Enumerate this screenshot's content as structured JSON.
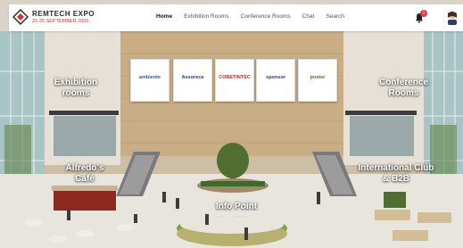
{
  "header": {
    "logo_title": "REMTECH EXPO",
    "logo_subtitle": "21-25 SEPTEMBER 2020",
    "nav": [
      "Home",
      "Exhibition Rooms",
      "Conference Rooms",
      "Chat",
      "Search"
    ],
    "notification_count": "1"
  },
  "scene": {
    "hotspots": {
      "exhibition": "Exhibition rooms",
      "conference": "Conference Rooms",
      "cafe": "Alfredo's Café",
      "club": "International Club & B2B",
      "info": "Info Point"
    },
    "banners": [
      "ambiente",
      "Assoreca",
      "COBETINTEC",
      "sponsor",
      "poster"
    ]
  },
  "colors": {
    "accent_red": "#d2332f",
    "topbar": "#ffffff"
  }
}
